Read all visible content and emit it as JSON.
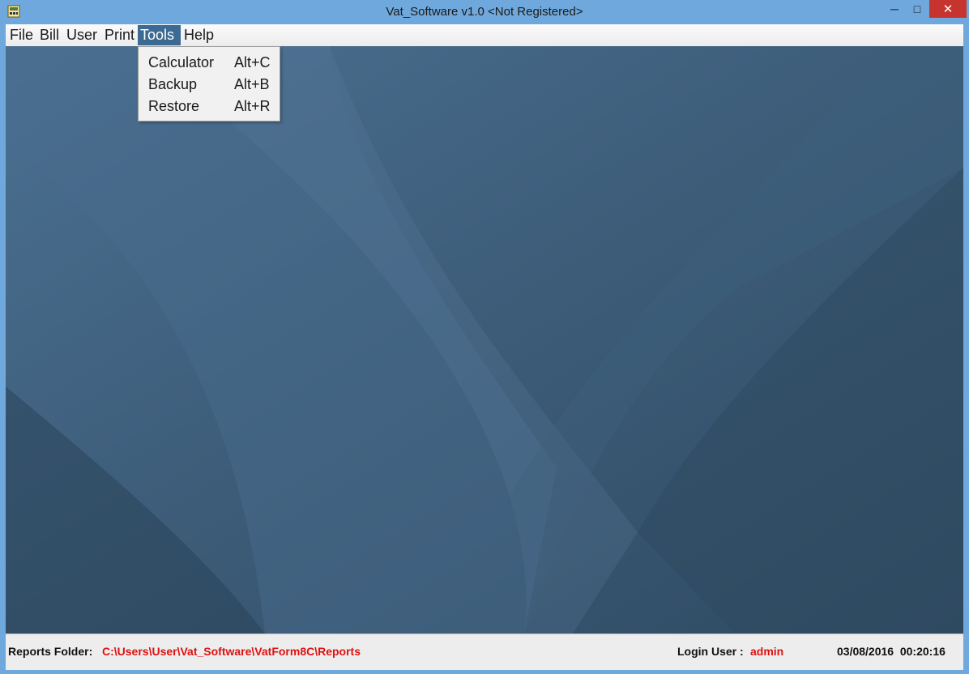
{
  "window": {
    "title": "Vat_Software v1.0 <Not Registered>",
    "controls": {
      "minimize": "─",
      "maximize": "□",
      "close": "✕"
    }
  },
  "menubar": {
    "items": [
      "File",
      "Bill",
      "User",
      "Print",
      "Tools",
      "Help"
    ],
    "active": "Tools"
  },
  "tools_menu": {
    "items": [
      {
        "label": "Calculator",
        "shortcut": "Alt+C"
      },
      {
        "label": "Backup",
        "shortcut": "Alt+B"
      },
      {
        "label": "Restore",
        "shortcut": "Alt+R"
      }
    ]
  },
  "statusbar": {
    "reports_folder_label": "Reports Folder:",
    "reports_folder_path": "C:\\Users\\User\\Vat_Software\\VatForm8C\\Reports",
    "login_user_label": "Login User :",
    "login_user_value": "admin",
    "datetime": "03/08/2016  00:20:16"
  },
  "colors": {
    "titlebar": "#6fa8dc",
    "desktop": "#3b5a76",
    "menu_active": "#3c6a92",
    "status_value": "#e01010",
    "close_button": "#c7342f"
  },
  "icons": [
    "app-icon",
    "minimize-icon",
    "maximize-icon",
    "close-icon"
  ]
}
